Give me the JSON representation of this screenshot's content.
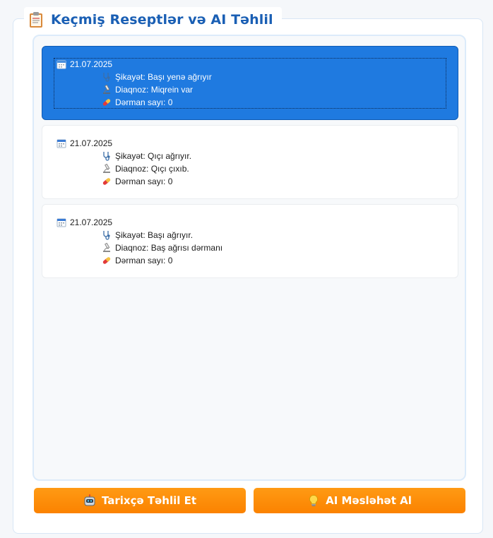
{
  "header": {
    "title": "Keçmiş Reseptlər və AI Təhlil",
    "icon": "clipboard-icon"
  },
  "prescriptions": [
    {
      "date": "21.07.2025",
      "complaint": "Şikayət: Başı yenə ağrıyır",
      "diagnosis": "Diaqnoz: Miqrein var",
      "medicine_count": "Dərman sayı: 0",
      "selected": true
    },
    {
      "date": "21.07.2025",
      "complaint": "Şikayət: Qıçı ağrıyır.",
      "diagnosis": "Diaqnoz: Qıçı çıxıb.",
      "medicine_count": "Dərman sayı: 0",
      "selected": false
    },
    {
      "date": "21.07.2025",
      "complaint": "Şikayət: Başı ağrıyır.",
      "diagnosis": "Diaqnoz: Baş ağrısı dərmanı",
      "medicine_count": "Dərman sayı: 0",
      "selected": false
    }
  ],
  "actions": {
    "analyze_history_label": "Tarixçə Təhlil Et",
    "analyze_history_icon": "robot-icon",
    "get_advice_label": "AI Məsləhət Al",
    "get_advice_icon": "light-bulb-icon"
  },
  "colors": {
    "title": "#1a5fb4",
    "selected_card": "#1f7ae0",
    "button": "#fb8200"
  }
}
